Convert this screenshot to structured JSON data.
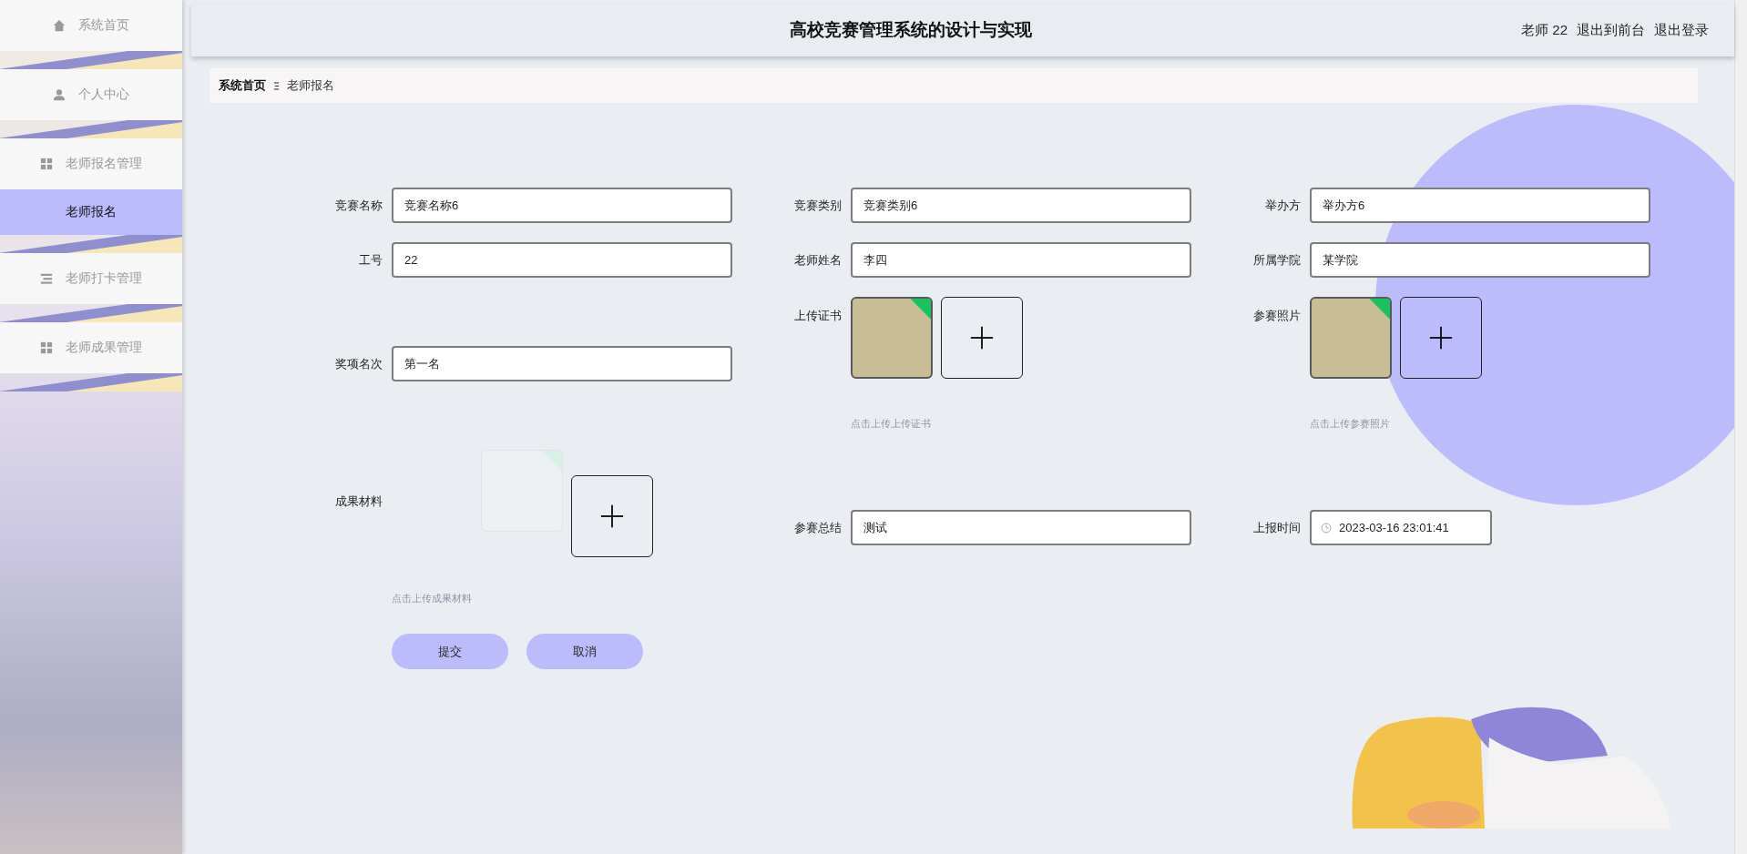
{
  "sidebar": {
    "items": [
      {
        "label": "系统首页",
        "kind": "menu",
        "selected": false
      },
      {
        "label": "个人中心",
        "kind": "menu",
        "selected": false
      },
      {
        "label": "老师报名管理",
        "kind": "menu",
        "selected": false
      },
      {
        "label": "老师报名",
        "kind": "submenu",
        "selected": true
      },
      {
        "label": "老师打卡管理",
        "kind": "menu",
        "selected": false
      },
      {
        "label": "老师成果管理",
        "kind": "menu",
        "selected": false
      }
    ]
  },
  "header": {
    "title": "高校竞赛管理系统的设计与实现",
    "user": "老师 22",
    "links": [
      "退出到前台",
      "退出登录"
    ]
  },
  "breadcrumb": [
    "系统首页",
    "老师报名"
  ],
  "form": {
    "fields": [
      {
        "label": "竞赛名称",
        "kind": "text",
        "value": "竞赛名称6"
      },
      {
        "label": "竞赛类别",
        "kind": "text",
        "value": "竞赛类别6"
      },
      {
        "label": "举办方",
        "kind": "text",
        "value": "举办方6"
      },
      {
        "label": "工号",
        "kind": "text",
        "value": "22"
      },
      {
        "label": "老师姓名",
        "kind": "text",
        "value": "李四"
      },
      {
        "label": "所属学院",
        "kind": "text",
        "value": "某学院"
      },
      {
        "label": "奖项名次",
        "kind": "text",
        "value": "第一名"
      },
      {
        "label": "上传证书",
        "kind": "upload",
        "files": [
          {
            "kind": "photo"
          }
        ],
        "hint": "点击上传上传证书"
      },
      {
        "label": "参赛照片",
        "kind": "upload",
        "files": [
          {
            "kind": "photo"
          }
        ],
        "hint": "点击上传参赛照片"
      },
      {
        "label": "成果材料",
        "kind": "upload",
        "files": [
          {
            "kind": "empty"
          }
        ],
        "hint": "点击上传成果材料"
      },
      {
        "label": "参赛总结",
        "kind": "text",
        "value": "测试"
      },
      {
        "label": "上报时间",
        "kind": "date",
        "value": "2023-03-16 23:01:41"
      }
    ],
    "buttons": [
      "提交",
      "取消"
    ]
  }
}
